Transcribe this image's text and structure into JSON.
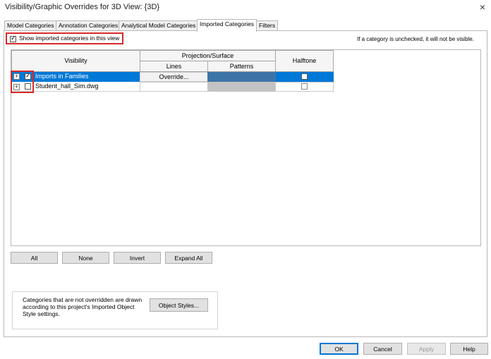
{
  "window": {
    "title": "Visibility/Graphic Overrides for 3D View: {3D}",
    "close_glyph": "×"
  },
  "tabs": [
    {
      "label": "Model Categories"
    },
    {
      "label": "Annotation Categories"
    },
    {
      "label": "Analytical Model Categories"
    },
    {
      "label": "Imported Categories"
    },
    {
      "label": "Filters"
    }
  ],
  "show_imported": {
    "label": "Show imported categories in this view",
    "checked": true
  },
  "hint": "If a category is unchecked, it will not be visible.",
  "grid": {
    "headers": {
      "visibility": "Visibility",
      "projection_surface": "Projection/Surface",
      "lines": "Lines",
      "patterns": "Patterns",
      "halftone": "Halftone"
    },
    "rows": [
      {
        "name": "Imports in Families",
        "visible": true,
        "lines": "Override...",
        "halftone": false,
        "selected": true
      },
      {
        "name": "Student_hall_Sim.dwg",
        "visible": false,
        "lines": "",
        "halftone": false,
        "selected": false
      }
    ]
  },
  "grid_buttons": {
    "all": "All",
    "none": "None",
    "invert": "Invert",
    "expand_all": "Expand All"
  },
  "info": {
    "text": "Categories that are not overridden are drawn according to this project's Imported Object Style settings.",
    "object_styles_button": "Object Styles..."
  },
  "footer": {
    "ok": "OK",
    "cancel": "Cancel",
    "apply": "Apply",
    "help": "Help"
  },
  "colors": {
    "selection": "#0078d7",
    "highlight_red": "#d62a2a",
    "pattern_blue": "#3d74a8"
  },
  "icons": {
    "expand": "+",
    "check": "✓"
  }
}
